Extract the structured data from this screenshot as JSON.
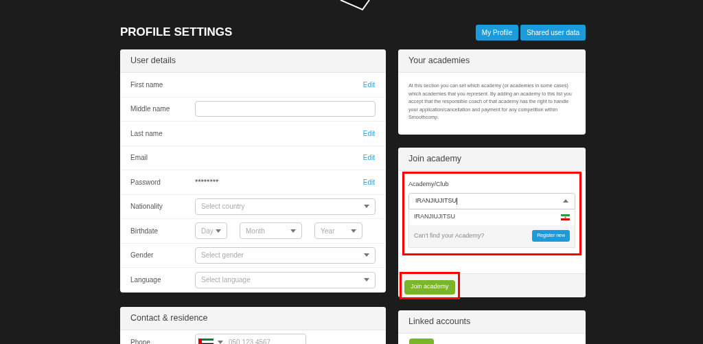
{
  "page": {
    "title": "PROFILE SETTINGS",
    "header_buttons": [
      "My Profile",
      "Shared user data"
    ]
  },
  "user_details": {
    "title": "User details",
    "rows": [
      {
        "kind": "text",
        "label": "First name",
        "action": "Edit"
      },
      {
        "kind": "input",
        "label": "Middle name"
      },
      {
        "kind": "text",
        "label": "Last name",
        "action": "Edit"
      },
      {
        "kind": "text",
        "label": "Email",
        "action": "Edit"
      },
      {
        "kind": "text",
        "label": "Password",
        "value": "********",
        "action": "Edit"
      },
      {
        "kind": "select",
        "label": "Nationality",
        "placeholder": "Select country"
      },
      {
        "kind": "date",
        "label": "Birthdate",
        "parts": [
          "Day",
          "Month",
          "Year"
        ]
      },
      {
        "kind": "select",
        "label": "Gender",
        "placeholder": "Select gender"
      },
      {
        "kind": "select",
        "label": "Language",
        "placeholder": "Select language"
      }
    ]
  },
  "contact": {
    "title": "Contact & residence",
    "phone": {
      "label": "Phone",
      "placeholder": "050 123 4567"
    }
  },
  "your_academies": {
    "title": "Your academies",
    "text": "At this section you can set which academy (or academies in some cases) which academies that you represent. By adding an academy to this list you accept that the responsible coach of that academy has the right to handle your application/cancellation and payment for any competition within Smoothcomp."
  },
  "join_academy": {
    "title": "Join academy",
    "field_label": "Academy/Club",
    "value": "IRANJIUJITSU",
    "expanded": true,
    "option": "IRANJIUJITSU",
    "not_found": "Can't find your Academy?",
    "register": "Register new",
    "submit": "Join academy",
    "highlighted": true
  },
  "linked_accounts": {
    "title": "Linked accounts"
  }
}
